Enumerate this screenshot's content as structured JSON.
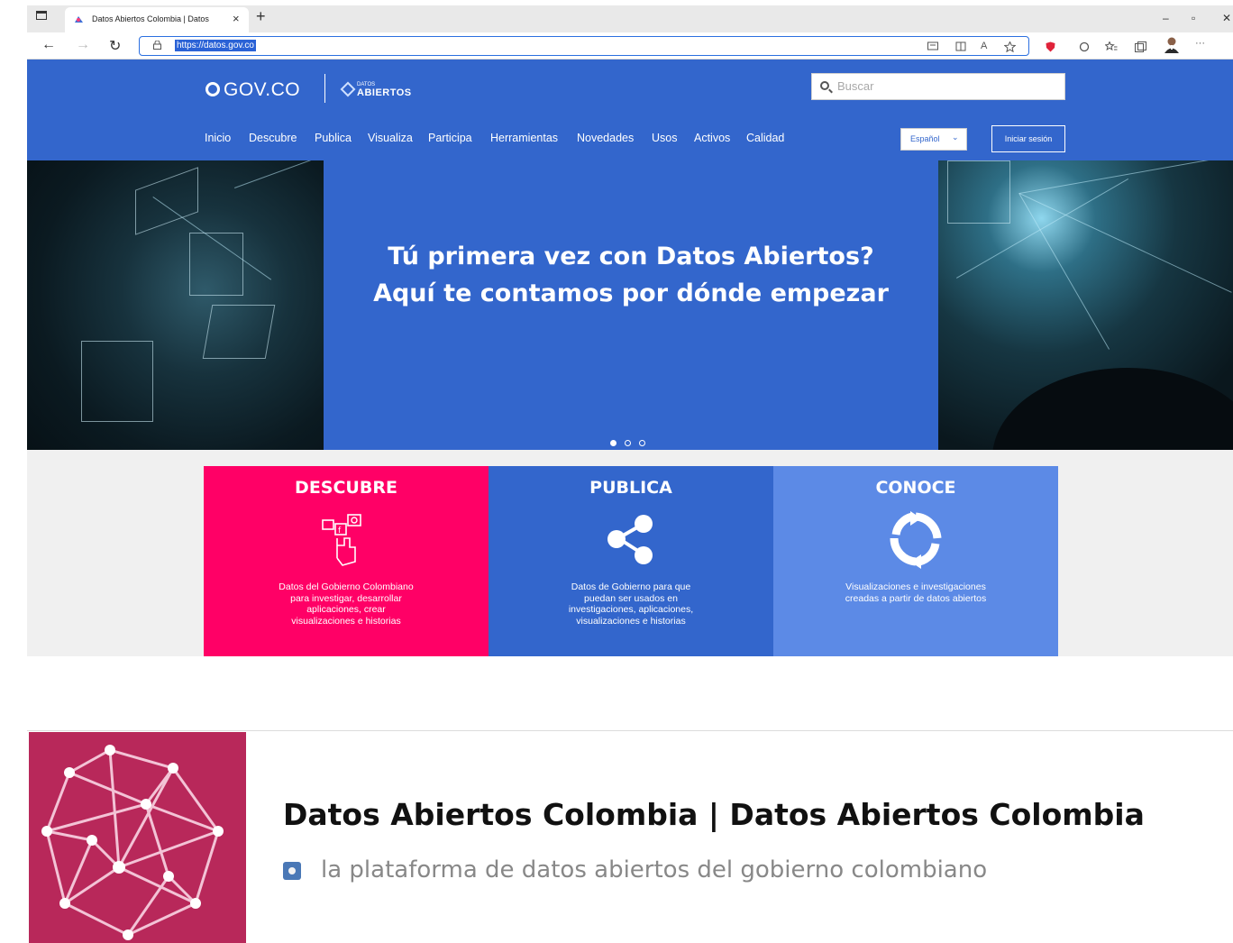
{
  "browser": {
    "tab_title": "Datos Abiertos Colombia | Datos",
    "tab_close": "×",
    "new_tab": "+",
    "url": "https://datos.gov.co",
    "minimize": "–",
    "restore": "▫",
    "close": "✕",
    "back": "←",
    "forward": "→",
    "reload": "↻",
    "more": "···"
  },
  "header": {
    "gov_logo": "GOV.CO",
    "da_logo_small": "DATOS",
    "da_logo_big": "ABIERTOS",
    "search_placeholder": "Buscar",
    "nav": [
      "Inicio",
      "Descubre",
      "Publica",
      "Visualiza",
      "Participa",
      "Herramientas",
      "Novedades",
      "Usos",
      "Activos",
      "Calidad"
    ],
    "language": "Español",
    "login": "Iniciar sesión"
  },
  "hero": {
    "line1": "Tú primera vez con Datos Abiertos?",
    "line2": "Aquí te contamos por dónde empezar"
  },
  "cards": [
    {
      "title": "DESCUBRE",
      "desc": "Datos del Gobierno Colombiano para investigar, desarrollar aplicaciones, crear visualizaciones e historias",
      "color": "#ff0066",
      "icon": "social-hand-icon"
    },
    {
      "title": "PUBLICA",
      "desc": "Datos de Gobierno para que puedan ser usados en investigaciones, aplicaciones, visualizaciones e historias",
      "color": "#3366cc",
      "icon": "share-icon"
    },
    {
      "title": "CONOCE",
      "desc": "Visualizaciones e investigaciones creadas a partir de datos abiertos",
      "color": "#5c8ae6",
      "icon": "refresh-icon"
    }
  ],
  "preview": {
    "title": "Datos Abiertos Colombia | Datos Abiertos Colombia",
    "description": "la plataforma de datos abiertos del gobierno colombiano"
  },
  "colors": {
    "brand_blue": "#3366cc",
    "magenta": "#ff0066",
    "light_blue": "#5c8ae6",
    "thumb_bg": "#b8285a"
  }
}
